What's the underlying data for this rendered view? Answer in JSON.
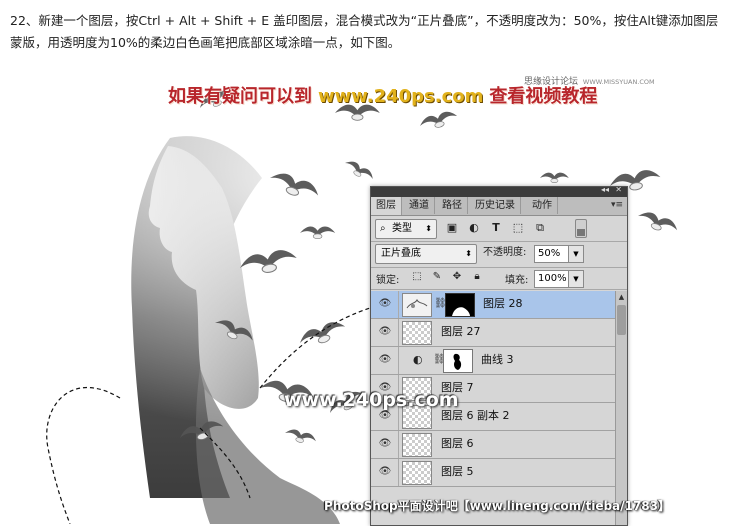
{
  "instruction": "22、新建一个图层，按Ctrl + Alt + Shift + E 盖印图层，混合模式改为“正片叠底”，不透明度改为：50%，按住Alt键添加图层蒙版，用透明度为10%的柔边白色画笔把底部区域涂暗一点，如下图。",
  "watermark_top": "思缘设计论坛",
  "watermark_top_url": "WWW.MISSYUAN.COM",
  "banner": {
    "prefix": "如果有疑问可以到",
    "url": "www.240ps.com",
    "suffix": "查看视频教程"
  },
  "overlay_url": "www.240ps.com",
  "credit": "PhotoShop平面设计吧【www.lineng.com/tieba/1783】",
  "panel": {
    "tabs": [
      {
        "label": "图层",
        "active": true
      },
      {
        "label": "通道",
        "active": false
      },
      {
        "label": "路径",
        "active": false
      },
      {
        "label": "历史记录",
        "active": false
      },
      {
        "label": "动作",
        "active": false
      }
    ],
    "kind_filter": "类型",
    "blend_mode": "正片叠底",
    "opacity_label": "不透明度:",
    "opacity_value": "50%",
    "lock_label": "锁定:",
    "fill_label": "填充:",
    "fill_value": "100%",
    "layers": [
      {
        "name": "图层 28",
        "selected": true
      },
      {
        "name": "图层 27"
      },
      {
        "name": "曲线 3"
      },
      {
        "name": "图层 7"
      },
      {
        "name": "图层 6 副本 2"
      },
      {
        "name": "图层 6"
      },
      {
        "name": "图层 5"
      }
    ]
  },
  "colors": {
    "banner_red": "#b8262b",
    "banner_url_gold": "#e2b21c",
    "selected_layer": "#a9c5ea",
    "panel_bg": "#d6d6d6"
  }
}
